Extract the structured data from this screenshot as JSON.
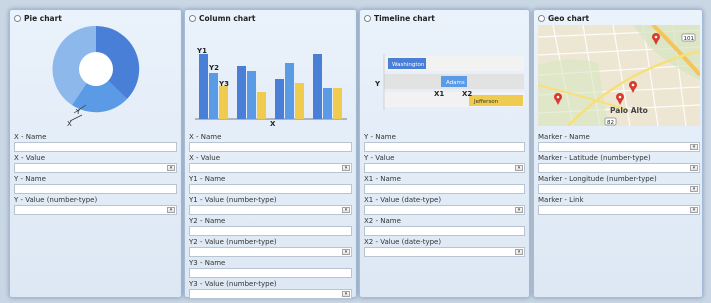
{
  "panels": {
    "pie": {
      "title": "Pie chart",
      "preview_labels": {
        "x": "X",
        "y": "Y"
      },
      "fields": [
        {
          "label": "X - Name",
          "type": "text"
        },
        {
          "label": "X - Value",
          "type": "select"
        },
        {
          "label": "Y - Name",
          "type": "text"
        },
        {
          "label": "Y - Value (number-type)",
          "type": "select"
        }
      ]
    },
    "column": {
      "title": "Column chart",
      "preview_labels": {
        "y1": "Y1",
        "y2": "Y2",
        "y3": "Y3",
        "x": "X"
      },
      "fields": [
        {
          "label": "X - Name",
          "type": "text"
        },
        {
          "label": "X - Value",
          "type": "select"
        },
        {
          "label": "Y1 - Name",
          "type": "text"
        },
        {
          "label": "Y1 - Value (number-type)",
          "type": "select"
        },
        {
          "label": "Y2 - Name",
          "type": "text"
        },
        {
          "label": "Y2 - Value (number-type)",
          "type": "select"
        },
        {
          "label": "Y3 - Name",
          "type": "text"
        },
        {
          "label": "Y3 - Value (number-type)",
          "type": "select"
        }
      ]
    },
    "timeline": {
      "title": "Timeline chart",
      "preview_labels": {
        "y": "Y",
        "x1": "X1",
        "x2": "X2",
        "bar1": "Washington",
        "bar2": "Adams",
        "bar3": "Jefferson"
      },
      "fields": [
        {
          "label": "Y - Name",
          "type": "text"
        },
        {
          "label": "Y - Value",
          "type": "select"
        },
        {
          "label": "X1 - Name",
          "type": "text"
        },
        {
          "label": "X1 - Value (date-type)",
          "type": "select"
        },
        {
          "label": "X2 - Name",
          "type": "text"
        },
        {
          "label": "X2 - Value (date-type)",
          "type": "select"
        }
      ]
    },
    "geo": {
      "title": "Geo chart",
      "preview_labels": {
        "city": "Palo Alto",
        "route1": "82",
        "route2": "101"
      },
      "fields": [
        {
          "label": "Marker - Name",
          "type": "select"
        },
        {
          "label": "Marker - Latitude (number-type)",
          "type": "select"
        },
        {
          "label": "Marker - Longitude (number-type)",
          "type": "select"
        },
        {
          "label": "Marker - Link",
          "type": "select"
        }
      ]
    }
  },
  "colors": {
    "blue_dark": "#4a7fd8",
    "blue_mid": "#5b9ae4",
    "blue_light": "#8cb8ec",
    "yellow": "#efcb50"
  }
}
